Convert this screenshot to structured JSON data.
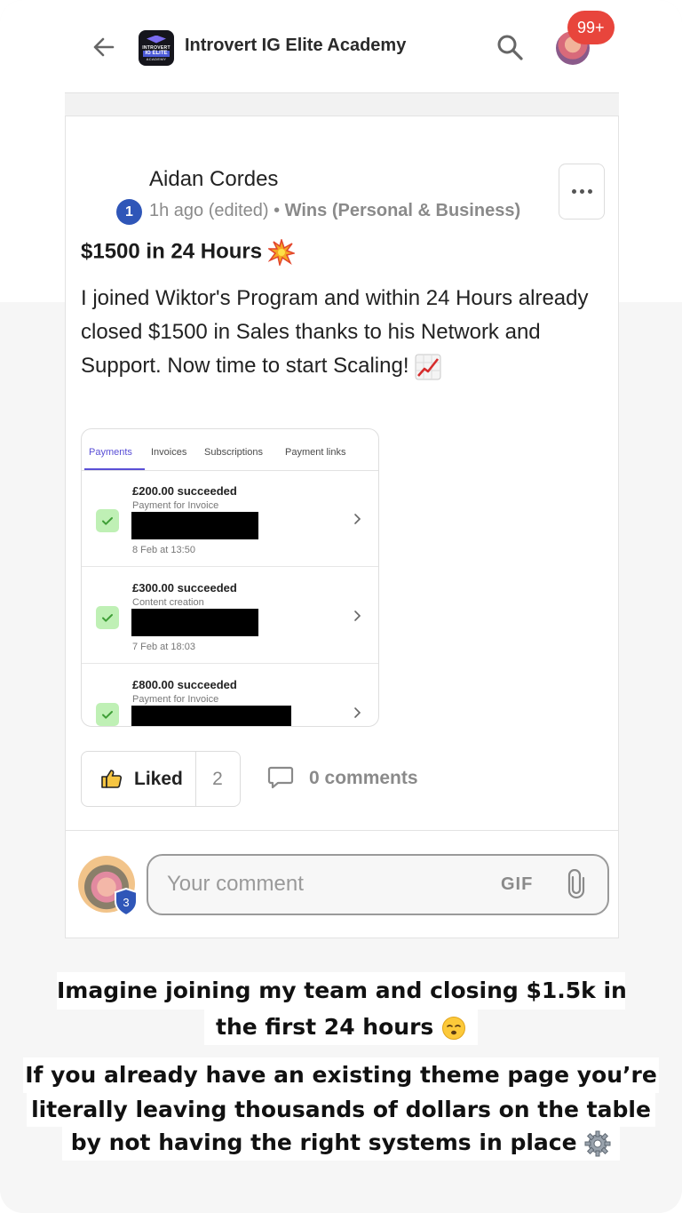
{
  "header": {
    "back_icon": "back-arrow-icon",
    "app_title": "Introvert IG Elite Academy",
    "logo_lines": [
      "INTROVERT",
      "IG ELITE",
      "ACADEMY"
    ],
    "search_icon": "search-icon",
    "notifications_badge": "99+"
  },
  "post": {
    "author": "Aidan Cordes",
    "level": "1",
    "time": "1h ago (edited)",
    "separator": " • ",
    "category": "Wins (Personal & Business)",
    "more_icon": "more-icon",
    "title": "$1500 in 24 Hours",
    "title_emoji": "explosion-emoji",
    "body": "I joined Wiktor's Program and within 24 Hours already closed $1500 in Sales thanks to his Network and Support. Now time to start Scaling!",
    "body_emoji": "chart-increasing-emoji",
    "screenshot": {
      "tabs": [
        "Payments",
        "Invoices",
        "Subscriptions",
        "Payment links"
      ],
      "active_tab": "Payments",
      "payments": [
        {
          "amount": "£200.00 succeeded",
          "description": "Payment for Invoice",
          "date": "8 Feb at 13:50"
        },
        {
          "amount": "£300.00 succeeded",
          "description": "Content creation",
          "date": "7 Feb at 18:03"
        },
        {
          "amount": "£800.00 succeeded",
          "description": "Payment for Invoice",
          "date": ""
        }
      ]
    },
    "liked_label": "Liked",
    "like_count": "2",
    "comments_label": "0 comments"
  },
  "comment_box": {
    "placeholder": "Your comment",
    "gif_label": "GIF",
    "user_level": "3"
  },
  "captions": {
    "line1a": "Imagine joining my team and closing $1.5k in",
    "line1b": "the first 24 hours",
    "line2a": "If you already have an existing theme page you’re",
    "line2b": "literally leaving thousands of dollars on the table",
    "line2c": "by not having the right systems in place"
  },
  "colors": {
    "accent_purple": "#5a4fd6",
    "badge_red": "#e8453c",
    "level_blue": "#2f56b8",
    "success_green": "#bff0b5"
  }
}
